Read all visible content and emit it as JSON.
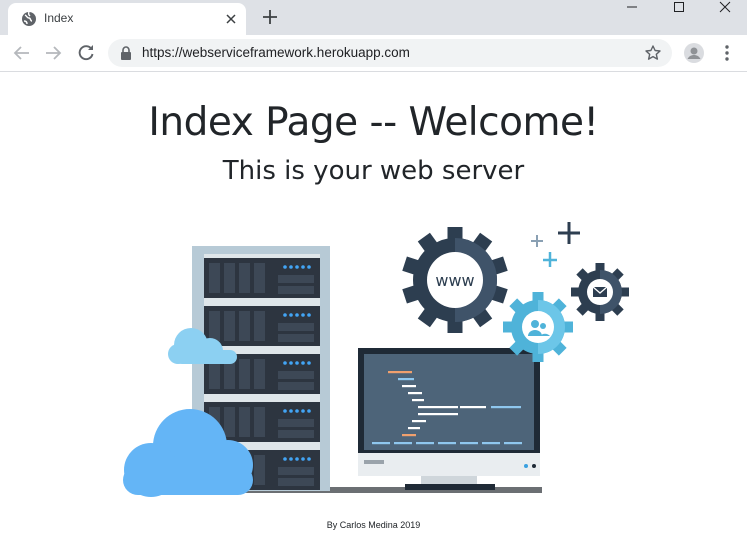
{
  "browser": {
    "tab": {
      "title": "Index"
    },
    "address_bar": {
      "url": "https://webserviceframework.herokuapp.com"
    }
  },
  "page": {
    "heading": "Index Page -- Welcome!",
    "subheading": "This is your web server",
    "hero_label": "www",
    "footer": "By Carlos Medina 2019"
  },
  "icons": {
    "tab_favicon": "globe-icon",
    "tab_close": "close-icon",
    "new_tab": "plus-icon",
    "back": "arrow-left-icon",
    "forward": "arrow-right-icon",
    "reload": "reload-icon",
    "lock": "lock-icon",
    "bookmark": "star-icon",
    "profile": "avatar-icon",
    "menu": "kebab-menu-icon"
  },
  "colors": {
    "tabstrip_bg": "#dee1e6",
    "omnibox_bg": "#f1f3f4",
    "text": "#212529",
    "cloud": "#64b5f6",
    "gear_dark": "#2d3e50",
    "gear_light": "#4fb3d9"
  }
}
